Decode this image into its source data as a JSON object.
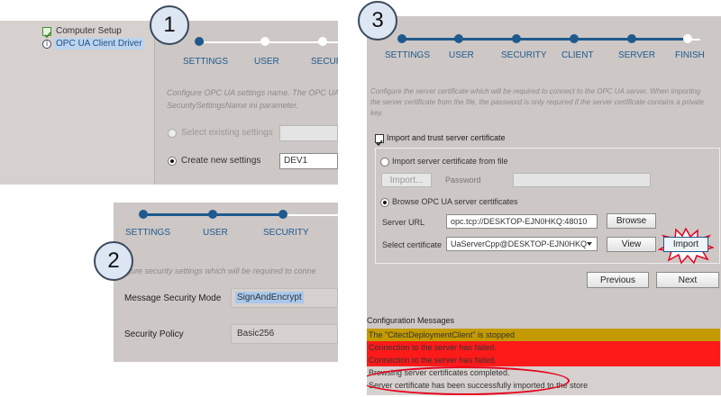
{
  "panel1": {
    "tree": [
      {
        "label": "Computer Setup",
        "icon": "checkmark-icon"
      },
      {
        "label": "OPC UA Client Driver",
        "icon": "info-icon"
      }
    ],
    "steps": [
      "SETTINGS",
      "USER",
      "SECURI"
    ],
    "description_line1": "Configure OPC UA settings name. The OPC UA",
    "description_line2": "SecuritySettingsName ini parameter.",
    "option_existing": "Select existing settings",
    "option_new": "Create new settings",
    "new_settings_value": "DEV1"
  },
  "panel2": {
    "steps": [
      "SETTINGS",
      "USER",
      "SECURITY"
    ],
    "description": "gure security settings which will be required to conne",
    "mode_label": "Message Security Mode",
    "mode_value": "SignAndEncrypt",
    "policy_label": "Security Policy",
    "policy_value": "Basic256"
  },
  "panel3": {
    "steps": [
      "SETTINGS",
      "USER",
      "SECURITY",
      "CLIENT",
      "SERVER",
      "FINISH"
    ],
    "description_line1": "Configure the server certificate which will be required to connect to the OPC UA server. When importing",
    "description_line2": "the server certificate from the file, the password is only required if the server certificate contains a private",
    "description_line3": "key.",
    "import_trust_label": "Import and trust server certificate",
    "import_from_file_label": "Import server certificate from file",
    "import_button": "Import...",
    "password_label": "Password",
    "browse_label": "Browse OPC UA server certificates",
    "server_url_label": "Server URL",
    "server_url_value": "opc.tcp://DESKTOP-EJN0HKQ:48010",
    "browse_button": "Browse",
    "select_cert_label": "Select certificate",
    "select_cert_value": "UaServerCpp@DESKTOP-EJN0HKQ",
    "view_button": "View",
    "import2_button": "Import",
    "previous_button": "Previous",
    "next_button": "Next",
    "messages_title": "Configuration Messages",
    "messages": [
      {
        "text": "The \"CitectDeploymentClient\" is stopped",
        "color": "#c39a00"
      },
      {
        "text": "Connection to the server has failed.",
        "color": "#ff1a1a"
      },
      {
        "text": "Connection to the server has failed.",
        "color": "#ff1a1a"
      },
      {
        "text": "Browsing server certificates completed.",
        "color": ""
      },
      {
        "text": "Server certificate has been successfully imported to the store",
        "color": ""
      }
    ]
  },
  "badges": [
    "1",
    "2",
    "3"
  ],
  "colors": {
    "accent": "#1f5a8e",
    "panel": "#cdc7c5",
    "highlight": "#e8001c"
  }
}
